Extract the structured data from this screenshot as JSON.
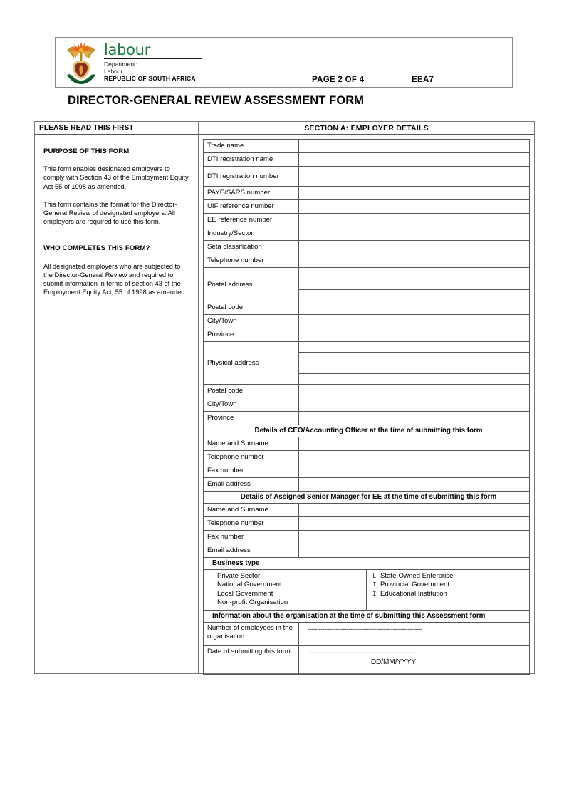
{
  "header": {
    "logo_word": "labour",
    "department_line1": "Department:",
    "department_line2": "Labour",
    "country": "REPUBLIC OF SOUTH AFRICA",
    "page_number": "PAGE 2 OF 4",
    "form_code": "EEA7"
  },
  "title": "DIRECTOR-GENERAL REVIEW ASSESSMENT FORM",
  "left_panel": {
    "heading": "PLEASE READ THIS FIRST",
    "purpose_heading": "PURPOSE OF THIS FORM",
    "purpose_para1": "This form enables designated employers to comply with Section 43 of the Employment Equity Act 55 of 1998 as amended.",
    "purpose_para2": "This form contains the format for the Director-General Review of designated employers. All employers are required to use this form.",
    "who_heading": "WHO COMPLETES THIS FORM?",
    "who_para1": "All designated employers who are subjected to the Director-General Review and required to submit information in terms of section 43 of the Employment Equity Act, 55 of 1998 as amended."
  },
  "section_a": {
    "heading": "SECTION A: EMPLOYER DETAILS",
    "fields": [
      {
        "label": "Trade name",
        "value": ""
      },
      {
        "label": "DTI registration name",
        "value": ""
      },
      {
        "label": "DTI registration number",
        "value": ""
      },
      {
        "label": "PAYE/SARS number",
        "value": ""
      },
      {
        "label": "UIF reference number",
        "value": ""
      },
      {
        "label": "EE reference number",
        "value": ""
      },
      {
        "label": "Industry/Sector",
        "value": ""
      },
      {
        "label": "Seta classification",
        "value": ""
      },
      {
        "label": "Telephone number",
        "value": ""
      }
    ],
    "postal_address_label": "Postal address",
    "postal_address_lines": [
      "",
      "",
      ""
    ],
    "postal_block": [
      {
        "label": "Postal code",
        "value": ""
      },
      {
        "label": "City/Town",
        "value": ""
      },
      {
        "label": "Province",
        "value": ""
      }
    ],
    "physical_address_label": "Physical  address",
    "physical_address_lines": [
      "",
      "",
      "",
      ""
    ],
    "physical_block": [
      {
        "label": "Postal code",
        "value": ""
      },
      {
        "label": "City/Town",
        "value": ""
      },
      {
        "label": "Province",
        "value": ""
      }
    ],
    "ceo_heading": "Details of CEO/Accounting Officer at the time of submitting this form",
    "ceo_fields": [
      {
        "label": "Name and Surname",
        "value": ""
      },
      {
        "label": "Telephone number",
        "value": ""
      },
      {
        "label": "Fax number",
        "value": ""
      },
      {
        "label": "Email address",
        "value": ""
      }
    ],
    "manager_heading": "Details of Assigned Senior Manager for EE at the time of submitting this form",
    "manager_fields": [
      {
        "label": "Name and Surname",
        "value": ""
      },
      {
        "label": "Telephone number",
        "value": ""
      },
      {
        "label": "Fax number",
        "value": ""
      },
      {
        "label": "Email address",
        "value": ""
      }
    ],
    "business_type_heading": "Business type",
    "business_type_left": [
      {
        "mark": "_",
        "label": "Private Sector"
      },
      {
        "mark": "",
        "label": "National Government"
      },
      {
        "mark": "",
        "label": "Local Government"
      },
      {
        "mark": "",
        "label": "Non-profit Organisation"
      }
    ],
    "business_type_right": [
      {
        "mark": "L",
        "label": "State-Owned Enterprise"
      },
      {
        "mark": "I",
        "label": "Provincial Government"
      },
      {
        "mark": "I",
        "label": "Educational Institution"
      }
    ],
    "org_info_heading": "Information about the organisation at the time of submitting this Assessment form",
    "employees_label": "Number of  employees in the organisation",
    "employees_value": "--------------------------------------------------------------",
    "date_label": "Date of submitting this form",
    "date_value": "-----------------------------------------------------------",
    "date_format_hint": "DD/MM/YYYY"
  },
  "colors": {
    "logo_green": "#1d7a3e",
    "border": "#555555",
    "frame_border": "#777777"
  }
}
